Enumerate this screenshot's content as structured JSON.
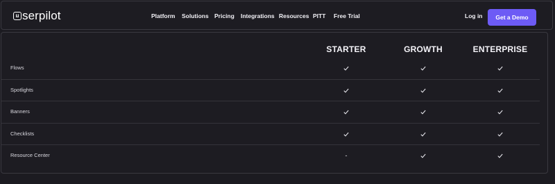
{
  "brand": {
    "logo_mark": "u",
    "logo_text": "serpilot"
  },
  "nav": {
    "items": [
      "Platform",
      "Solutions",
      "Pricing",
      "Integrations",
      "Resources",
      "PITT",
      "Free Trial"
    ]
  },
  "header_actions": {
    "login_label": "Log in",
    "demo_label": "Get a Demo"
  },
  "comparison": {
    "plans": [
      "STARTER",
      "GROWTH",
      "ENTERPRISE"
    ],
    "rows": [
      {
        "feature": "Flows",
        "starter": "check",
        "growth": "check",
        "enterprise": "check"
      },
      {
        "feature": "Spotlights",
        "starter": "check",
        "growth": "check",
        "enterprise": "check"
      },
      {
        "feature": "Banners",
        "starter": "check",
        "growth": "check",
        "enterprise": "check"
      },
      {
        "feature": "Checklists",
        "starter": "check",
        "growth": "check",
        "enterprise": "check"
      },
      {
        "feature": "Resource Center",
        "starter": "-",
        "growth": "check",
        "enterprise": "check"
      }
    ]
  },
  "colors": {
    "background": "#1c1b21",
    "accent": "#6d5bf5",
    "text": "#f2f1f6",
    "border": "#3a3940"
  },
  "icons": {
    "included": "checkmark-icon",
    "not_included": "dash"
  }
}
